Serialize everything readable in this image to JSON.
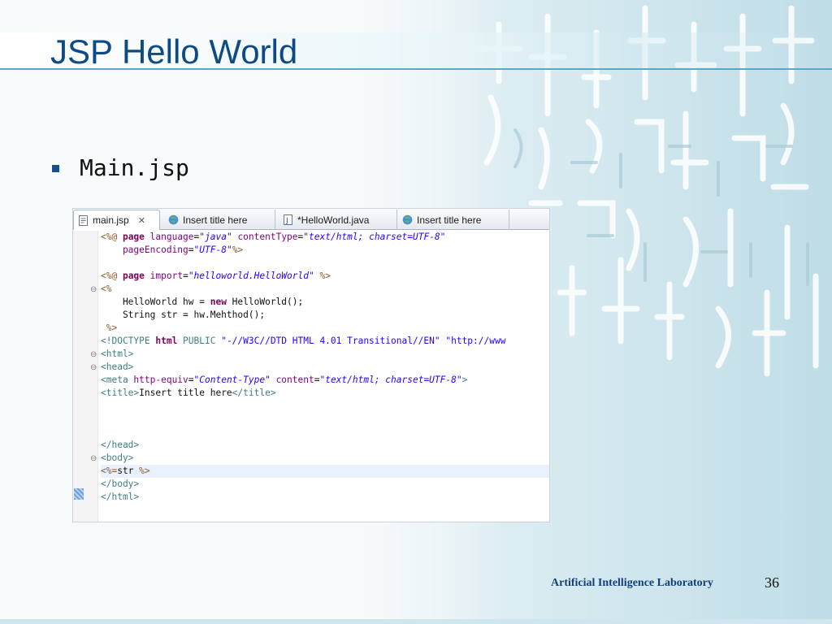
{
  "slide": {
    "title": "JSP Hello World",
    "bullet": "Main.jsp",
    "footer": "Artificial Intelligence Laboratory",
    "page_number": "36"
  },
  "colors": {
    "title": "#0e4a86",
    "title_rule": "#5aa9c4",
    "bullet": "#1a4f8c",
    "footer": "#12407a",
    "tag": "#3f7f7f",
    "attribute": "#7f007f",
    "string": "#2a00ff",
    "keyword": "#7f0055",
    "directive": "#8a5a2b"
  },
  "editor": {
    "tabs": [
      {
        "label": "main.jsp",
        "icon": "jsp-file-icon",
        "active": true,
        "close": "✕"
      },
      {
        "label": "Insert title here",
        "icon": "globe-icon",
        "active": false
      },
      {
        "label": "*HelloWorld.java",
        "icon": "java-file-icon",
        "active": false
      },
      {
        "label": "Insert title here",
        "icon": "globe-icon",
        "active": false
      }
    ],
    "fold_markers": [
      "⊖",
      "⊖",
      "⊖",
      "⊖"
    ],
    "lines": {
      "l1": {
        "a": "<%@ ",
        "b": "page ",
        "c": "language",
        "d": "=",
        "e": "\"java\"",
        "f": " contentType",
        "g": "=",
        "h": "\"text/html; charset=UTF-8\""
      },
      "l2": {
        "a": "    pageEncoding",
        "b": "=",
        "c": "\"UTF-8\"",
        "d": "%>"
      },
      "l4": {
        "a": "<%@ ",
        "b": "page ",
        "c": "import",
        "d": "=",
        "e": "\"helloworld.HelloWorld\"",
        "f": " %>"
      },
      "l5": {
        "a": "<%"
      },
      "l6": {
        "a": "    HelloWorld hw = ",
        "b": "new",
        "c": " HelloWorld();"
      },
      "l7": {
        "a": "    String str = hw.Mehthod();"
      },
      "l8": {
        "a": " %>"
      },
      "l9": {
        "a": "<!DOCTYPE ",
        "b": "html ",
        "c": "PUBLIC ",
        "d": "\"-//W3C//DTD HTML 4.01 Transitional//EN\" \"http://www"
      },
      "l10": {
        "a": "<html>"
      },
      "l11": {
        "a": "<head>"
      },
      "l12": {
        "a": "<meta ",
        "b": "http-equiv",
        "c": "=",
        "d": "\"Content-Type\"",
        "e": " content",
        "f": "=",
        "g": "\"text/html; charset=UTF-8\"",
        "h": ">"
      },
      "l13": {
        "a": "<title>",
        "b": "Insert title here",
        "c": "</title>"
      },
      "l17": {
        "a": "</head>"
      },
      "l18": {
        "a": "<body>"
      },
      "l19": {
        "a": "<%=",
        "b": "str",
        "c": " %>"
      },
      "l20": {
        "a": "</body>"
      },
      "l21": {
        "a": "</html>"
      }
    }
  }
}
